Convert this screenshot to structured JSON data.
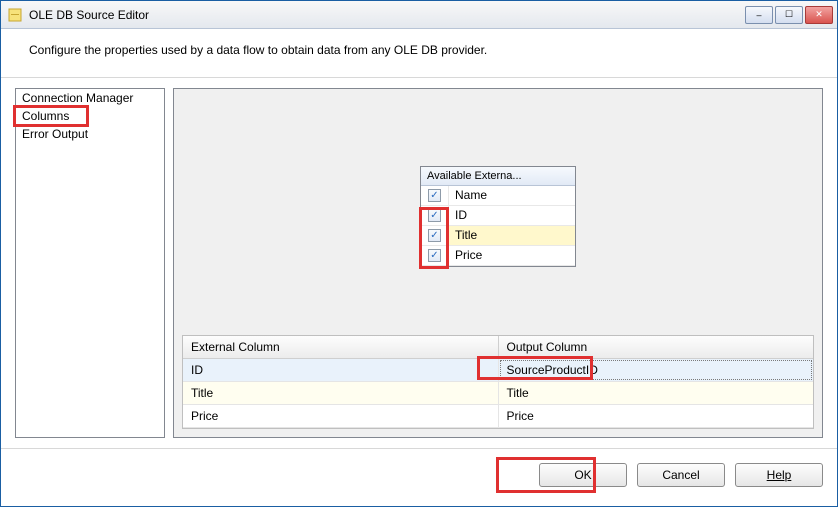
{
  "titlebar": {
    "title": "OLE DB Source Editor"
  },
  "description": "Configure the properties used by a data flow to obtain data from any OLE DB provider.",
  "nav": {
    "items": [
      {
        "label": "Connection Manager"
      },
      {
        "label": "Columns"
      },
      {
        "label": "Error Output"
      }
    ]
  },
  "available": {
    "header": "Available Externa...",
    "rows": [
      {
        "name": "Name",
        "checked": true,
        "selected": false
      },
      {
        "name": "ID",
        "checked": true,
        "selected": false
      },
      {
        "name": "Title",
        "checked": true,
        "selected": true
      },
      {
        "name": "Price",
        "checked": true,
        "selected": false
      }
    ]
  },
  "mapping": {
    "headers": {
      "external": "External Column",
      "output": "Output Column"
    },
    "rows": [
      {
        "external": "ID",
        "output": "SourceProductID",
        "selected": true,
        "alt": false
      },
      {
        "external": "Title",
        "output": "Title",
        "selected": false,
        "alt": true
      },
      {
        "external": "Price",
        "output": "Price",
        "selected": false,
        "alt": false
      }
    ]
  },
  "footer": {
    "ok": "OK",
    "cancel": "Cancel",
    "help": "Help"
  },
  "icons": {
    "check": "✓",
    "min": "–",
    "max": "☐",
    "close": "✕"
  }
}
